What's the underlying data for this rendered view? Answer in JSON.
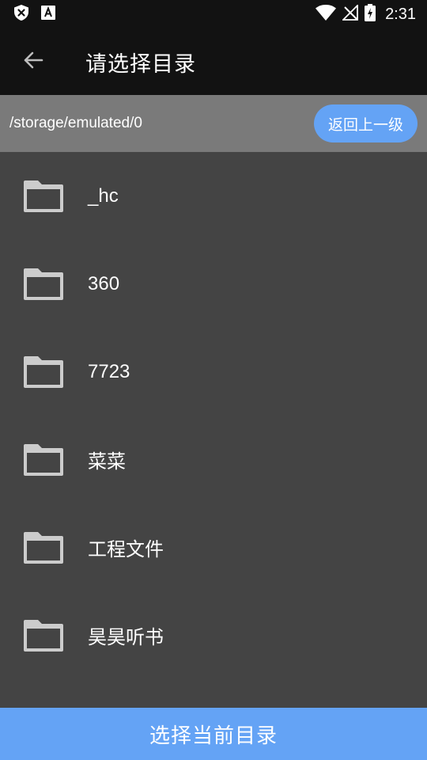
{
  "status_bar": {
    "time": "2:31",
    "icons": [
      "shield-x-icon",
      "font-a-icon",
      "wifi-icon",
      "no-sim-icon",
      "battery-charging-icon"
    ]
  },
  "app_bar": {
    "back_icon": "arrow-left-icon",
    "title": "请选择目录"
  },
  "path_bar": {
    "current_path": "/storage/emulated/0",
    "up_label": "返回上一级"
  },
  "folders": [
    {
      "name": "_hc"
    },
    {
      "name": "360"
    },
    {
      "name": "7723"
    },
    {
      "name": "菜菜"
    },
    {
      "name": "工程文件"
    },
    {
      "name": "昊昊听书"
    },
    {
      "name": ""
    }
  ],
  "footer": {
    "select_label": "选择当前目录"
  },
  "colors": {
    "accent": "#64a3f5",
    "app_bar": "#121212",
    "path_bar": "#7a7a7a",
    "list_bg": "#444444",
    "folder_icon": "#cccccc"
  }
}
